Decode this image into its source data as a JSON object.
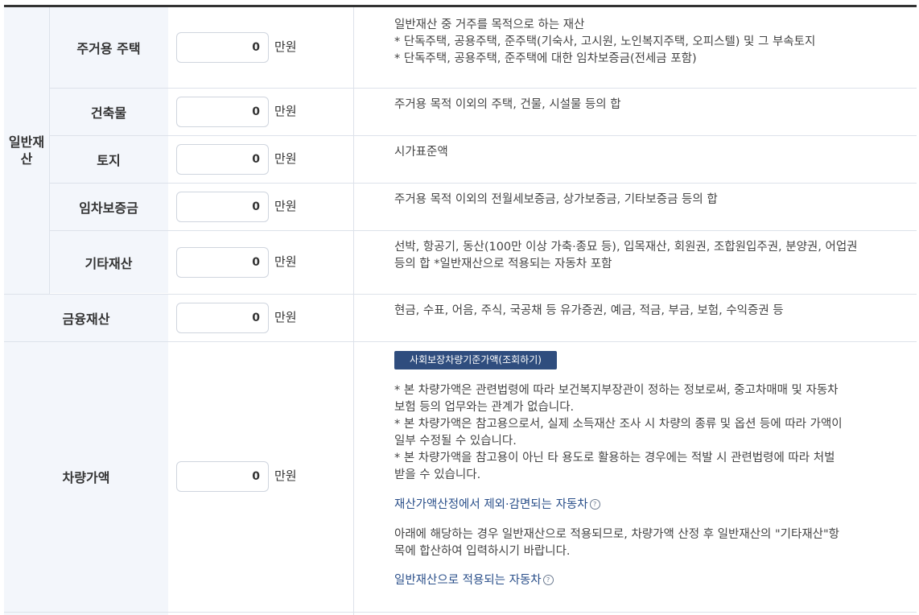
{
  "unit_label": "만원",
  "general_assets": {
    "group_label": "일반재산",
    "rows": [
      {
        "label": "주거용 주택",
        "value": "0",
        "desc": [
          "일반재산 중 거주를 목적으로 하는 재산",
          "* 단독주택, 공용주택, 준주택(기숙사, 고시원, 노인복지주택, 오피스텔) 및 그 부속토지",
          "* 단독주택, 공용주택, 준주택에 대한 임차보증금(전세금 포함)"
        ]
      },
      {
        "label": "건축물",
        "value": "0",
        "desc": [
          "주거용 목적 이외의 주택, 건물, 시설물 등의 합"
        ]
      },
      {
        "label": "토지",
        "value": "0",
        "desc": [
          "시가표준액"
        ]
      },
      {
        "label": "임차보증금",
        "value": "0",
        "desc": [
          "주거용 목적 이외의 전월세보증금, 상가보증금, 기타보증금 등의 합"
        ]
      },
      {
        "label": "기타재산",
        "value": "0",
        "desc": [
          "선박, 항공기, 동산(100만 이상 가축·종묘 등), 입목재산, 회원권, 조합원입주권, 분양권, 어업권",
          "등의 합 *일반재산으로 적용되는 자동차 포함"
        ]
      }
    ]
  },
  "financial_assets": {
    "label": "금융재산",
    "value": "0",
    "desc": [
      "현금, 수표, 어음, 주식, 국공채 등 유가증권, 예금, 적금, 부금, 보험, 수익증권 등"
    ]
  },
  "vehicle": {
    "label": "차량가액",
    "value": "0",
    "lookup_button": "사회보장차량기준가액(조회하기)",
    "notes": [
      "* 본 차량가액은 관련법령에 따라 보건복지부장관이 정하는 정보로써, 중고차매매 및 자동차",
      "보험 등의 업무와는 관계가 없습니다.",
      "* 본 차량가액은 참고용으로서, 실제 소득재산 조사 시 차량의 종류 및 옵션 등에 따라 가액이",
      "일부 수정될 수 있습니다.",
      "* 본 차량가액을 참고용이 아닌 타 용도로 활용하는 경우에는 적발 시 관련법령에 따라 처벌",
      "받을 수 있습니다."
    ],
    "exempt_link": "재산가액산정에서 제외·감면되는 자동차",
    "info_text": [
      "아래에 해당하는 경우 일반재산으로 적용되므로, 차량가액 산정 후 일반재산의 \"기타재산\"항",
      "목에 합산하여 입력하시기 바랍니다."
    ],
    "general_link": "일반재산으로 적용되는 자동차",
    "help_icon_glyph": "?"
  }
}
